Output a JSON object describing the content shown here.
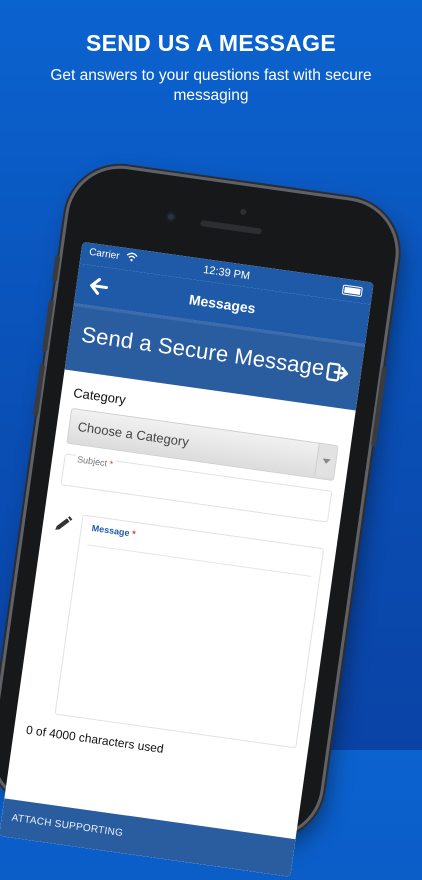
{
  "promo": {
    "headline": "SEND US A MESSAGE",
    "subtext": "Get answers to your questions fast with secure messaging"
  },
  "status_bar": {
    "carrier": "Carrier",
    "time": "12:39 PM"
  },
  "nav": {
    "back_icon": "arrow-left-icon",
    "title": "Messages"
  },
  "secure_header": {
    "title": "Send a Secure Message",
    "exit_icon": "sign-out-icon"
  },
  "form": {
    "category_label": "Category",
    "category_value": "Choose a Category",
    "subject_label": "Subject",
    "subject_required": "*",
    "message_label": "Message",
    "message_required": "*",
    "char_count": "0 of 4000 characters used",
    "attach_label": "ATTACH SUPPORTING"
  },
  "colors": {
    "background_top": "#0b63d0",
    "background_bottom": "#0a43a6",
    "app_blue": "#1e5aa8",
    "header_blue": "#2a5da0",
    "required_red": "#d23c3c"
  }
}
